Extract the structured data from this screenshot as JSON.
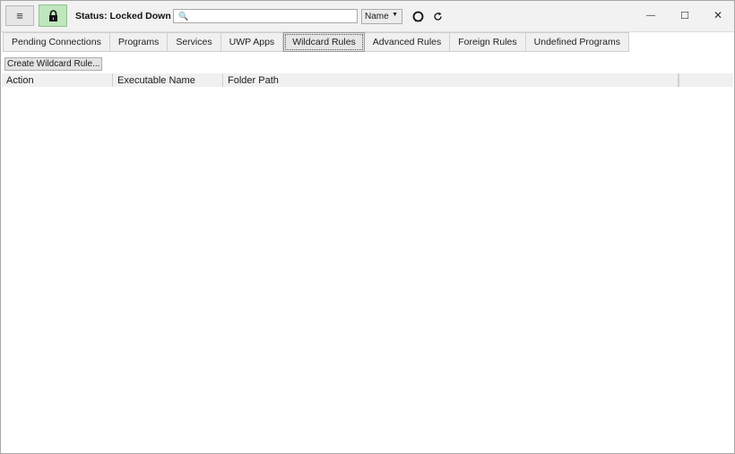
{
  "toolbar": {
    "menu_icon": "hamburger-icon",
    "lock_icon": "lock-icon",
    "status": "Status: Locked Down",
    "search": {
      "value": "",
      "placeholder": "",
      "icon": "search-icon"
    },
    "sort": {
      "selected": "Name"
    },
    "sync_icon": "sync-icon",
    "refresh_icon": "refresh-icon"
  },
  "window_controls": {
    "minimize": "—",
    "maximize": "☐",
    "close": "✕"
  },
  "tabs": [
    {
      "label": "Pending Connections",
      "active": false
    },
    {
      "label": "Programs",
      "active": false
    },
    {
      "label": "Services",
      "active": false
    },
    {
      "label": "UWP Apps",
      "active": false
    },
    {
      "label": "Wildcard Rules",
      "active": true
    },
    {
      "label": "Advanced Rules",
      "active": false
    },
    {
      "label": "Foreign Rules",
      "active": false
    },
    {
      "label": "Undefined Programs",
      "active": false
    }
  ],
  "actions": {
    "create_label": "Create Wildcard Rule..."
  },
  "grid": {
    "columns": [
      "Action",
      "Executable Name",
      "Folder Path"
    ],
    "rows": []
  },
  "colors": {
    "lock_button_bg": "#bfe6bd",
    "toolbar_bg": "#f2f2f2",
    "header_bg": "#f0f0f0"
  }
}
